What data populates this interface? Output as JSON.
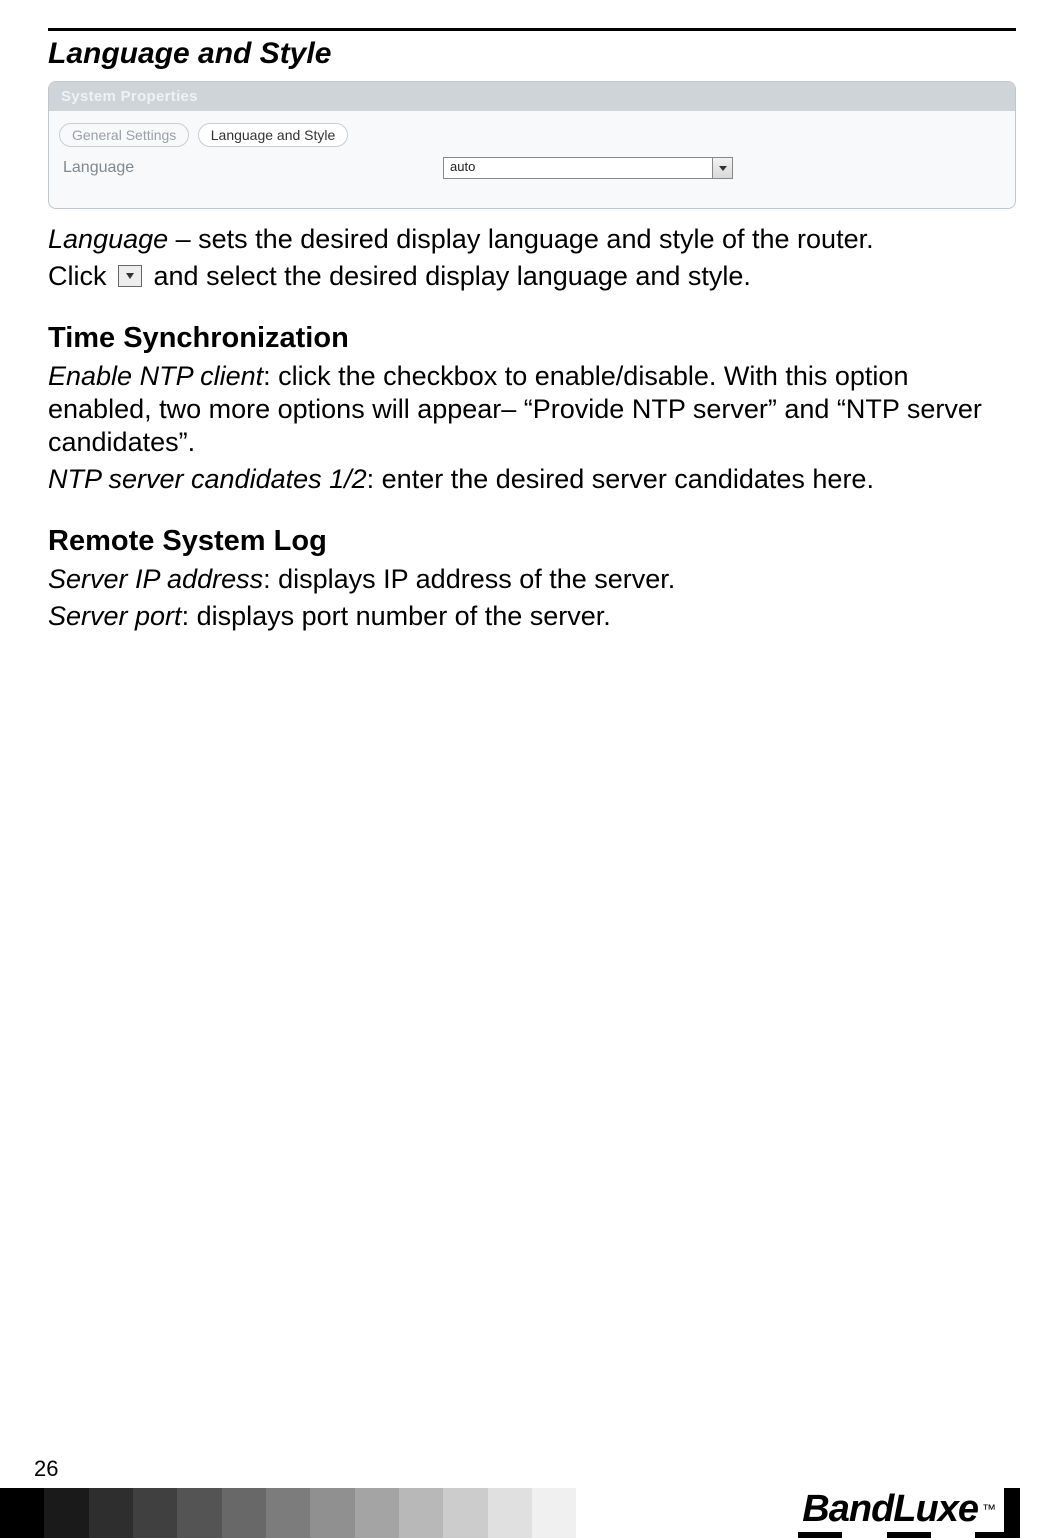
{
  "section1": {
    "title": "Language and Style"
  },
  "panel": {
    "title": "System Properties",
    "tab_inactive": "General Settings",
    "tab_active": "Language and Style",
    "row_label": "Language",
    "select_value": "auto"
  },
  "para1a_italic": "Language",
  "para1a_rest": " – sets the desired display language and style of the router.",
  "para1b_before": "Click ",
  "para1b_after": " and select the desired display language and style.",
  "section2": {
    "heading": "Time Synchronization",
    "p1_italic": "Enable NTP client",
    "p1_rest": ":    click the checkbox to enable/disable. With this option enabled, two more options will appear– “Provide NTP server” and “NTP server candidates”.",
    "p2_italic": "NTP server candidates 1/2",
    "p2_rest": ":   enter the desired server candidates here."
  },
  "section3": {
    "heading": "Remote System Log",
    "p1_italic": "Server IP address",
    "p1_rest": ":    displays IP address of the server.",
    "p2_italic": "Server port",
    "p2_rest": ":    displays port number of the server."
  },
  "footer": {
    "page_number": "26",
    "logo": "BandLuxe",
    "tm": "™",
    "grad_colors": [
      "#000000",
      "#1a1a1a",
      "#2e2e2e",
      "#404040",
      "#545454",
      "#686868",
      "#7c7c7c",
      "#909090",
      "#a4a4a4",
      "#b8b8b8",
      "#cccccc",
      "#e0e0e0",
      "#f0f0f0",
      "#ffffff",
      "#ffffff",
      "#ffffff",
      "#ffffff",
      "#ffffff",
      "#000000",
      "#ffffff",
      "#000000",
      "#ffffff",
      "#000000",
      "#ffffff"
    ]
  }
}
